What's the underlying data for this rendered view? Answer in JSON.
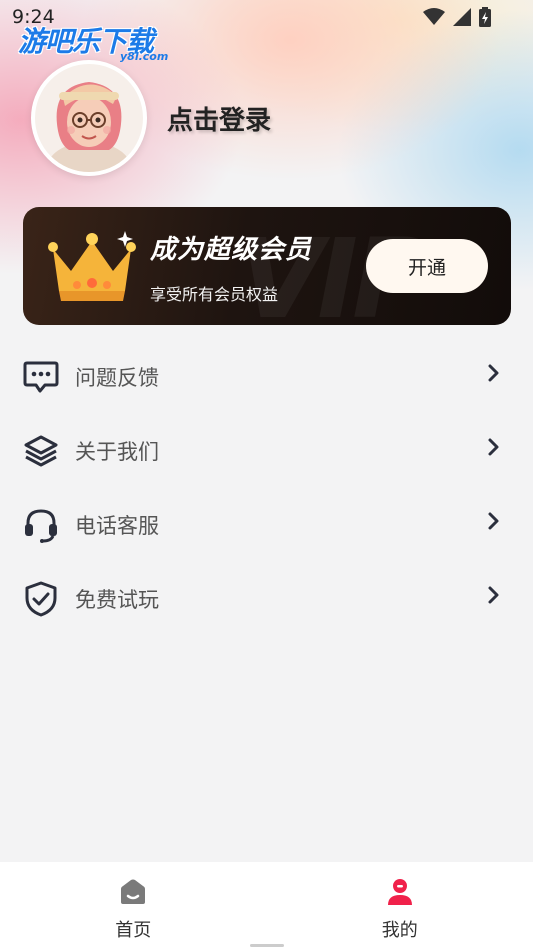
{
  "status_bar": {
    "time": "9:24"
  },
  "watermark": {
    "text": "游吧乐下载",
    "sub": "y8l.com"
  },
  "profile": {
    "login_label": "点击登录"
  },
  "vip": {
    "bg_text": "VIP",
    "title": "成为超级会员",
    "subtitle": "享受所有会员权益",
    "button_label": "开通"
  },
  "menu": {
    "items": [
      {
        "label": "问题反馈",
        "icon": "chat-dots-icon"
      },
      {
        "label": "关于我们",
        "icon": "layers-icon"
      },
      {
        "label": "电话客服",
        "icon": "headset-icon"
      },
      {
        "label": "免费试玩",
        "icon": "shield-check-icon"
      }
    ]
  },
  "tabbar": {
    "items": [
      {
        "label": "首页",
        "icon": "home-icon",
        "active": false
      },
      {
        "label": "我的",
        "icon": "user-icon",
        "active": true
      }
    ]
  },
  "colors": {
    "accent": "#f0214a",
    "tab_inactive": "#7a7a7a",
    "menu_icon": "#2b2f3d"
  }
}
